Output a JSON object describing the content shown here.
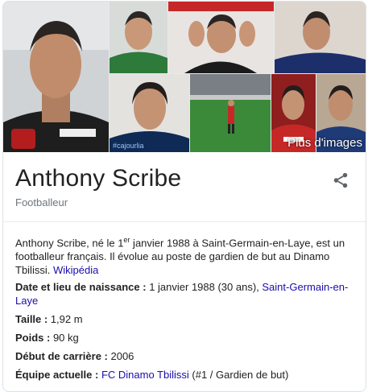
{
  "entity": {
    "name": "Anthony Scribe",
    "type": "Footballeur"
  },
  "gallery": {
    "more_label": "Plus d'images",
    "watermark": "#cajourlia"
  },
  "description": {
    "part1": "Anthony Scribe, né le 1",
    "sup": "er",
    "part2": " janvier 1988 à Saint-Germain-en-Laye, est un footballeur français. Il évolue au poste de gardien de but au Dinamo Tbilissi. ",
    "source_link": "Wikipédia"
  },
  "facts": {
    "birth": {
      "label": "Date et lieu de naissance :",
      "value": " 1 janvier 1988 (30 ans), ",
      "link": "Saint-Germain-en-Laye"
    },
    "height": {
      "label": "Taille :",
      "value": " 1,92 m"
    },
    "weight": {
      "label": "Poids :",
      "value": " 90 kg"
    },
    "career_start": {
      "label": "Début de carrière :",
      "value": " 2006"
    },
    "team": {
      "label": "Équipe actuelle :",
      "link": "FC Dinamo Tbilissi",
      "value": " (#1 / Gardien de but)"
    }
  },
  "colors": {
    "link": "#1a0dab",
    "secondary_text": "#70757a",
    "share_icon": "#5f6368"
  },
  "icons": {
    "share": "share-icon"
  }
}
